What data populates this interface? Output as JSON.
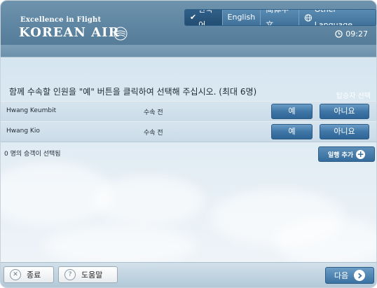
{
  "brand": {
    "tagline": "Excellence in Flight",
    "name": "KOREAN AIR"
  },
  "languages": [
    {
      "label": "한국어",
      "active": true
    },
    {
      "label": "English",
      "active": false
    },
    {
      "label": "简体中文",
      "active": false
    },
    {
      "label": "Other Language",
      "active": false
    }
  ],
  "clock": {
    "time": "09:27"
  },
  "breadcrumb": "탑승자 선택",
  "instruction": "함께 수속할 인원을 \"예\" 버튼을 클릭하여 선택해 주십시오. (최대 6명)",
  "passengers": [
    {
      "name": "Hwang Keumbit",
      "status": "수속 전",
      "yes_label": "예",
      "no_label": "아니요"
    },
    {
      "name": "Hwang Kio",
      "status": "수속 전",
      "yes_label": "예",
      "no_label": "아니요"
    }
  ],
  "selected_count_text": "0 명의 승객이 선택됨",
  "add_infant_label": "일행 추가",
  "footer": {
    "exit_label": "종료",
    "help_label": "도움말",
    "next_label": "다음"
  },
  "colors": {
    "header": "#5f86a2",
    "button_blue": "#3f76a6",
    "text": "#1f2b36"
  }
}
